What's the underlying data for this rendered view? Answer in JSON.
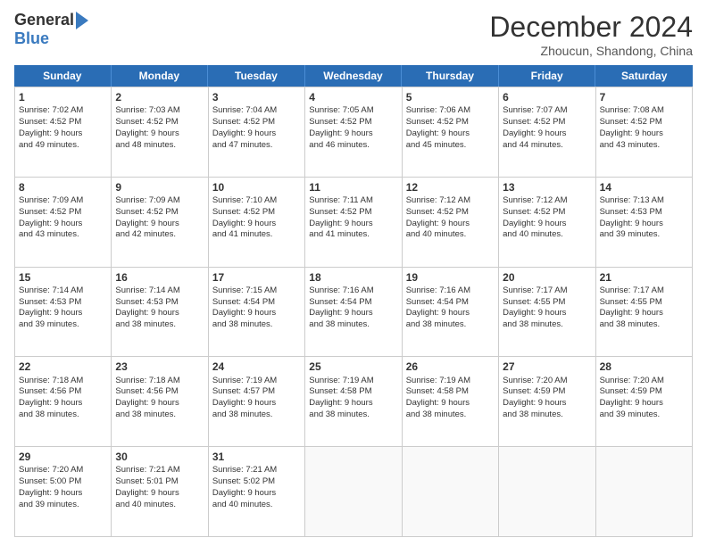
{
  "logo": {
    "general": "General",
    "blue": "Blue"
  },
  "title": "December 2024",
  "subtitle": "Zhoucun, Shandong, China",
  "header_days": [
    "Sunday",
    "Monday",
    "Tuesday",
    "Wednesday",
    "Thursday",
    "Friday",
    "Saturday"
  ],
  "weeks": [
    [
      {
        "day": "1",
        "lines": [
          "Sunrise: 7:02 AM",
          "Sunset: 4:52 PM",
          "Daylight: 9 hours",
          "and 49 minutes."
        ]
      },
      {
        "day": "2",
        "lines": [
          "Sunrise: 7:03 AM",
          "Sunset: 4:52 PM",
          "Daylight: 9 hours",
          "and 48 minutes."
        ]
      },
      {
        "day": "3",
        "lines": [
          "Sunrise: 7:04 AM",
          "Sunset: 4:52 PM",
          "Daylight: 9 hours",
          "and 47 minutes."
        ]
      },
      {
        "day": "4",
        "lines": [
          "Sunrise: 7:05 AM",
          "Sunset: 4:52 PM",
          "Daylight: 9 hours",
          "and 46 minutes."
        ]
      },
      {
        "day": "5",
        "lines": [
          "Sunrise: 7:06 AM",
          "Sunset: 4:52 PM",
          "Daylight: 9 hours",
          "and 45 minutes."
        ]
      },
      {
        "day": "6",
        "lines": [
          "Sunrise: 7:07 AM",
          "Sunset: 4:52 PM",
          "Daylight: 9 hours",
          "and 44 minutes."
        ]
      },
      {
        "day": "7",
        "lines": [
          "Sunrise: 7:08 AM",
          "Sunset: 4:52 PM",
          "Daylight: 9 hours",
          "and 43 minutes."
        ]
      }
    ],
    [
      {
        "day": "8",
        "lines": [
          "Sunrise: 7:09 AM",
          "Sunset: 4:52 PM",
          "Daylight: 9 hours",
          "and 43 minutes."
        ]
      },
      {
        "day": "9",
        "lines": [
          "Sunrise: 7:09 AM",
          "Sunset: 4:52 PM",
          "Daylight: 9 hours",
          "and 42 minutes."
        ]
      },
      {
        "day": "10",
        "lines": [
          "Sunrise: 7:10 AM",
          "Sunset: 4:52 PM",
          "Daylight: 9 hours",
          "and 41 minutes."
        ]
      },
      {
        "day": "11",
        "lines": [
          "Sunrise: 7:11 AM",
          "Sunset: 4:52 PM",
          "Daylight: 9 hours",
          "and 41 minutes."
        ]
      },
      {
        "day": "12",
        "lines": [
          "Sunrise: 7:12 AM",
          "Sunset: 4:52 PM",
          "Daylight: 9 hours",
          "and 40 minutes."
        ]
      },
      {
        "day": "13",
        "lines": [
          "Sunrise: 7:12 AM",
          "Sunset: 4:52 PM",
          "Daylight: 9 hours",
          "and 40 minutes."
        ]
      },
      {
        "day": "14",
        "lines": [
          "Sunrise: 7:13 AM",
          "Sunset: 4:53 PM",
          "Daylight: 9 hours",
          "and 39 minutes."
        ]
      }
    ],
    [
      {
        "day": "15",
        "lines": [
          "Sunrise: 7:14 AM",
          "Sunset: 4:53 PM",
          "Daylight: 9 hours",
          "and 39 minutes."
        ]
      },
      {
        "day": "16",
        "lines": [
          "Sunrise: 7:14 AM",
          "Sunset: 4:53 PM",
          "Daylight: 9 hours",
          "and 38 minutes."
        ]
      },
      {
        "day": "17",
        "lines": [
          "Sunrise: 7:15 AM",
          "Sunset: 4:54 PM",
          "Daylight: 9 hours",
          "and 38 minutes."
        ]
      },
      {
        "day": "18",
        "lines": [
          "Sunrise: 7:16 AM",
          "Sunset: 4:54 PM",
          "Daylight: 9 hours",
          "and 38 minutes."
        ]
      },
      {
        "day": "19",
        "lines": [
          "Sunrise: 7:16 AM",
          "Sunset: 4:54 PM",
          "Daylight: 9 hours",
          "and 38 minutes."
        ]
      },
      {
        "day": "20",
        "lines": [
          "Sunrise: 7:17 AM",
          "Sunset: 4:55 PM",
          "Daylight: 9 hours",
          "and 38 minutes."
        ]
      },
      {
        "day": "21",
        "lines": [
          "Sunrise: 7:17 AM",
          "Sunset: 4:55 PM",
          "Daylight: 9 hours",
          "and 38 minutes."
        ]
      }
    ],
    [
      {
        "day": "22",
        "lines": [
          "Sunrise: 7:18 AM",
          "Sunset: 4:56 PM",
          "Daylight: 9 hours",
          "and 38 minutes."
        ]
      },
      {
        "day": "23",
        "lines": [
          "Sunrise: 7:18 AM",
          "Sunset: 4:56 PM",
          "Daylight: 9 hours",
          "and 38 minutes."
        ]
      },
      {
        "day": "24",
        "lines": [
          "Sunrise: 7:19 AM",
          "Sunset: 4:57 PM",
          "Daylight: 9 hours",
          "and 38 minutes."
        ]
      },
      {
        "day": "25",
        "lines": [
          "Sunrise: 7:19 AM",
          "Sunset: 4:58 PM",
          "Daylight: 9 hours",
          "and 38 minutes."
        ]
      },
      {
        "day": "26",
        "lines": [
          "Sunrise: 7:19 AM",
          "Sunset: 4:58 PM",
          "Daylight: 9 hours",
          "and 38 minutes."
        ]
      },
      {
        "day": "27",
        "lines": [
          "Sunrise: 7:20 AM",
          "Sunset: 4:59 PM",
          "Daylight: 9 hours",
          "and 38 minutes."
        ]
      },
      {
        "day": "28",
        "lines": [
          "Sunrise: 7:20 AM",
          "Sunset: 4:59 PM",
          "Daylight: 9 hours",
          "and 39 minutes."
        ]
      }
    ],
    [
      {
        "day": "29",
        "lines": [
          "Sunrise: 7:20 AM",
          "Sunset: 5:00 PM",
          "Daylight: 9 hours",
          "and 39 minutes."
        ]
      },
      {
        "day": "30",
        "lines": [
          "Sunrise: 7:21 AM",
          "Sunset: 5:01 PM",
          "Daylight: 9 hours",
          "and 40 minutes."
        ]
      },
      {
        "day": "31",
        "lines": [
          "Sunrise: 7:21 AM",
          "Sunset: 5:02 PM",
          "Daylight: 9 hours",
          "and 40 minutes."
        ]
      },
      {
        "day": "",
        "lines": []
      },
      {
        "day": "",
        "lines": []
      },
      {
        "day": "",
        "lines": []
      },
      {
        "day": "",
        "lines": []
      }
    ]
  ]
}
